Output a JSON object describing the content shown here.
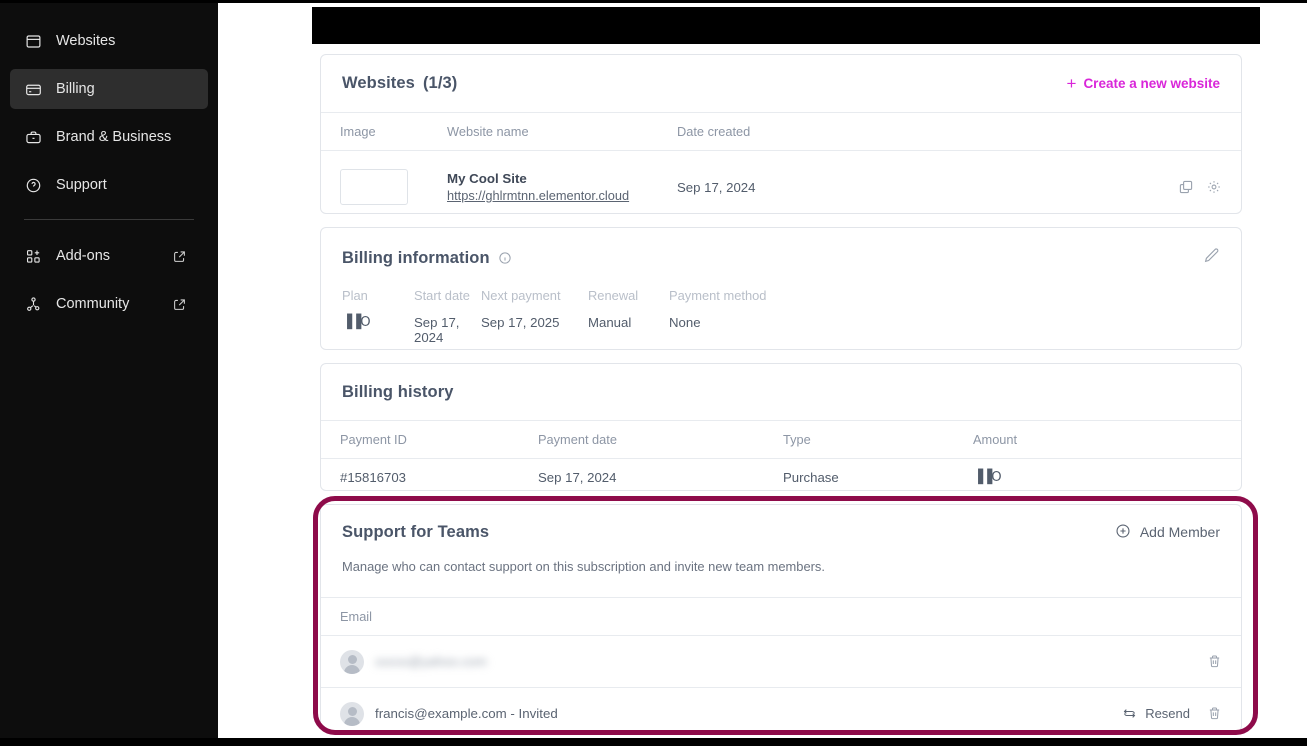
{
  "sidebar": {
    "items": [
      {
        "label": "Websites",
        "icon": "window-icon",
        "active": false,
        "external": false
      },
      {
        "label": "Billing",
        "icon": "credit-card-icon",
        "active": true,
        "external": false
      },
      {
        "label": "Brand & Business",
        "icon": "briefcase-icon",
        "active": false,
        "external": false
      },
      {
        "label": "Support",
        "icon": "question-circle-icon",
        "active": false,
        "external": false
      }
    ],
    "secondary_items": [
      {
        "label": "Add-ons",
        "icon": "grid-plus-icon",
        "external": true
      },
      {
        "label": "Community",
        "icon": "share-nodes-icon",
        "external": true
      }
    ]
  },
  "colors": {
    "accent_pink": "#d926d9",
    "highlight_border": "#8e0b4a",
    "sidebar_bg": "#0d0d0d",
    "sidebar_active_bg": "#2e2e2e"
  },
  "websites_card": {
    "title": "Websites",
    "count": "(1/3)",
    "create_label": "Create a new website",
    "create_icon": "plus-icon",
    "columns": [
      "Image",
      "Website name",
      "Date created"
    ],
    "rows": [
      {
        "thumbnail": "",
        "name": "My Cool Site",
        "url": "https://ghlrmtnn.elementor.cloud",
        "date_created": "Sep 17, 2024",
        "actions": [
          "duplicate-icon",
          "gear-icon"
        ]
      }
    ]
  },
  "billing_information": {
    "title": "Billing information",
    "info_icon": "info-circle-icon",
    "edit_icon": "pencil-icon",
    "fields": [
      {
        "label": "Plan",
        "value": "▐▐O"
      },
      {
        "label": "Start date",
        "value": "Sep 17, 2024"
      },
      {
        "label": "Next payment",
        "value": "Sep 17, 2025"
      },
      {
        "label": "Renewal",
        "value": "Manual"
      },
      {
        "label": "Payment method",
        "value": "None"
      }
    ]
  },
  "billing_history": {
    "title": "Billing history",
    "columns": [
      "Payment ID",
      "Payment date",
      "Type",
      "Amount"
    ],
    "rows": [
      {
        "payment_id": "#15816703",
        "payment_date": "Sep 17, 2024",
        "type": "Purchase",
        "amount": "▐▐O"
      }
    ]
  },
  "support_for_teams": {
    "title": "Support for Teams",
    "description": "Manage who can contact support on this subscription and invite new team members.",
    "add_member_label": "Add Member",
    "add_member_icon": "plus-circle-icon",
    "columns": [
      "Email"
    ],
    "members": [
      {
        "email": "xxxxx@yahoo.com",
        "redacted": true,
        "status": "",
        "resend_label": "",
        "delete_icon": "trash-icon"
      },
      {
        "email": "francis@example.com - Invited",
        "redacted": false,
        "status": "Invited",
        "resend_label": "Resend",
        "resend_icon": "refresh-icon",
        "delete_icon": "trash-icon"
      }
    ]
  }
}
